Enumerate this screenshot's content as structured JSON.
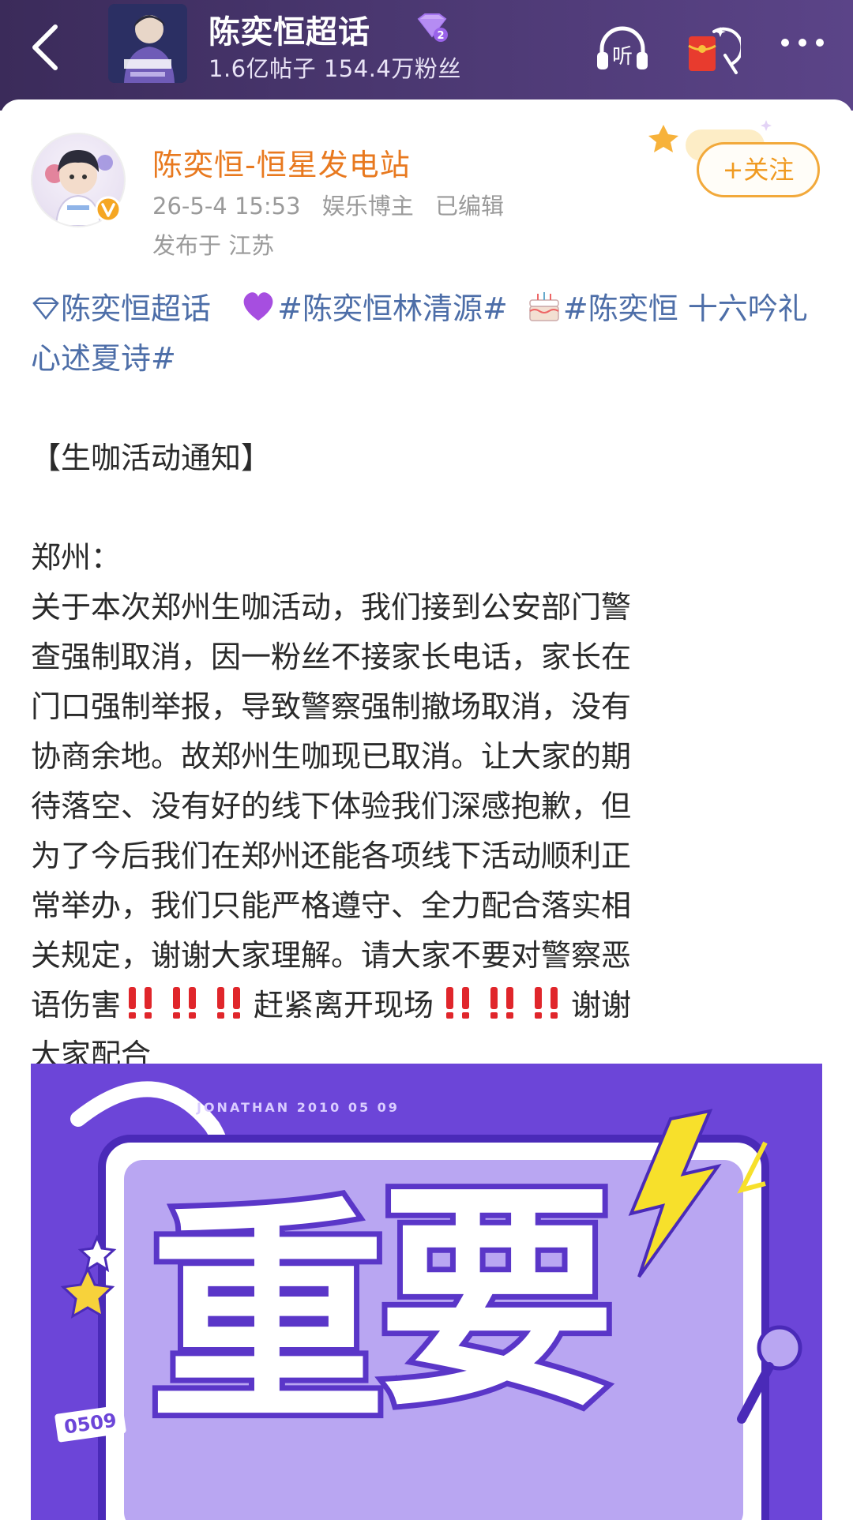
{
  "header": {
    "topic_title": "陈奕恒超话",
    "level_badge": "2",
    "stats": "1.6亿帖子 154.4万粉丝",
    "icons": [
      "back-arrow-icon",
      "listen-icon",
      "red-packet-icon",
      "more-icon"
    ],
    "listen_label": "听"
  },
  "author": {
    "name": "陈奕恒-恒星发电站",
    "date": "26-5-4 15:53",
    "role": "娱乐博主",
    "edited": "已编辑",
    "location": "发布于 江苏",
    "follow_label": "+关注"
  },
  "post": {
    "topic1": "陈奕恒超话",
    "topic2": "#陈奕恒林清源#",
    "topic3": "#陈奕恒 十六吟礼 心述夏诗#",
    "heading": "【生咖活动通知】",
    "city": "郑州：",
    "body": "关于本次郑州生咖活动，我们接到公安部门警查强制取消，因一粉丝不接家长电话，家长在门口强制举报，导致警察强制撤场取消，没有协商余地。故郑州生咖现已取消。让大家的期待落空、没有好的线下体验我们深感抱歉，但为了今后我们在郑州还能各项线下活动顺利正常举办，我们只能严格遵守、全力配合落实相关规定，谢谢大家理解。请大家不要对警察恶语伤害",
    "body2": "赶紧离开现场",
    "body3": "谢谢大家配合"
  },
  "image": {
    "caption": "JONATHAN 2010 05 09",
    "date_tag": "0509",
    "chars": [
      "重",
      "要"
    ]
  },
  "colors": {
    "header_bg": "#4a3770",
    "author_name": "#e8791f",
    "topic_link": "#4d6ea8",
    "follow": "#f09a20",
    "image_bg": "#6c45d8"
  }
}
